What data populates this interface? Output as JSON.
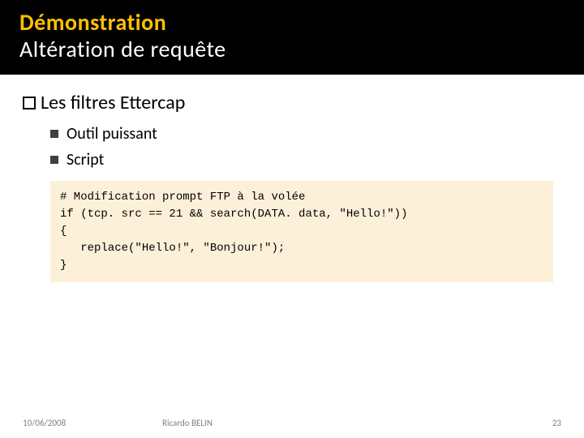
{
  "title": {
    "line1": "Démonstration",
    "line2": "Altération de requête"
  },
  "heading": "Les filtres Ettercap",
  "bullets": [
    "Outil puissant",
    "Script"
  ],
  "code": "# Modification prompt FTP à la volée\nif (tcp. src == 21 && search(DATA. data, \"Hello!\"))\n{\n   replace(\"Hello!\", \"Bonjour!\");\n}",
  "footer": {
    "date": "10/06/2008",
    "author": "Ricardo BELIN",
    "page": "23"
  }
}
